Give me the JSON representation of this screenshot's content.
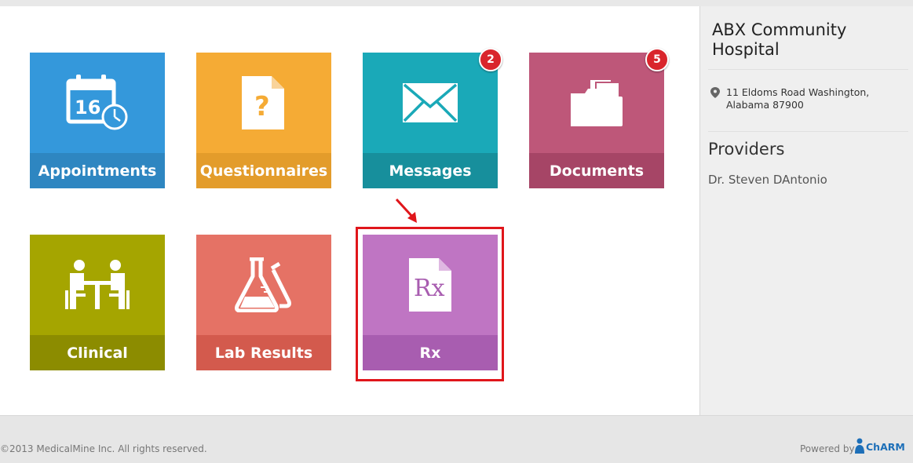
{
  "tiles": [
    {
      "label": "Appointments",
      "color": "#3498db",
      "bar_color": "#2e86c1",
      "icon": "calendar-clock-icon",
      "calendar_day": "16"
    },
    {
      "label": "Questionnaires",
      "color": "#f5ab35",
      "bar_color": "#e39c2b",
      "icon": "question-document-icon",
      "glyph": "?"
    },
    {
      "label": "Messages",
      "color": "#1aa9b8",
      "bar_color": "#178f9c",
      "icon": "envelope-icon",
      "badge": "2"
    },
    {
      "label": "Documents",
      "color": "#be5779",
      "bar_color": "#a64566",
      "icon": "folder-documents-icon",
      "badge": "5"
    },
    {
      "label": "Clinical",
      "color": "#a5a500",
      "bar_color": "#8c8c00",
      "icon": "consultation-icon"
    },
    {
      "label": "Lab Results",
      "color": "#e57265",
      "bar_color": "#d35a4d",
      "icon": "flask-icon"
    },
    {
      "label": "Rx",
      "color": "#bf75c3",
      "bar_color": "#a85db0",
      "icon": "prescription-document-icon",
      "glyph": "Rx"
    }
  ],
  "hospital": {
    "name": "ABX Community Hospital",
    "address": "11 Eldoms Road Washington, Alabama 87900"
  },
  "providers": {
    "title": "Providers",
    "list": [
      "Dr. Steven DAntonio"
    ]
  },
  "footer": {
    "copyright": "©2013 MedicalMine Inc. All rights reserved.",
    "powered_by": "Powered by",
    "brand": "ChARM"
  },
  "colors": {
    "badge": "#d9252c",
    "highlight": "#e0161b"
  }
}
